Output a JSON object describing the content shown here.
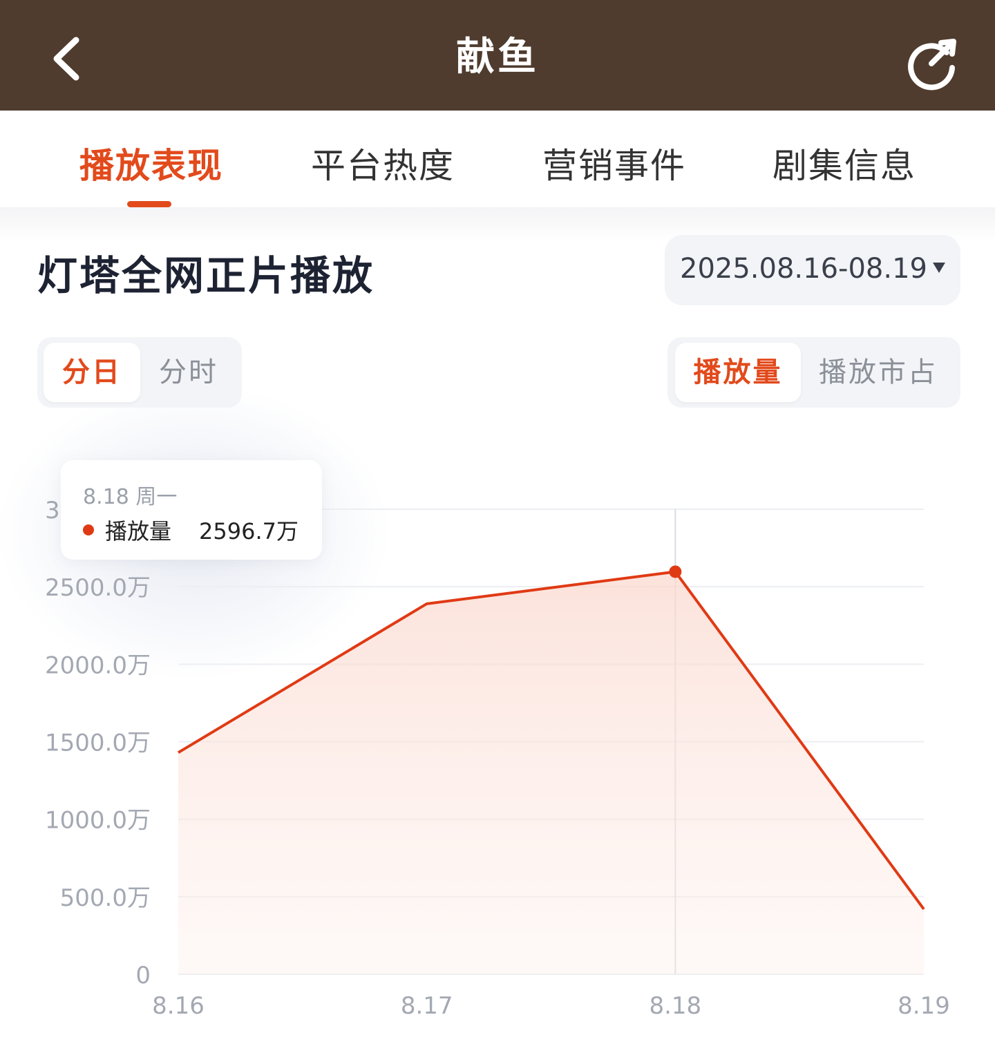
{
  "header": {
    "title": "献鱼",
    "back_icon": "chevron-left-icon",
    "refresh_icon": "refresh-icon",
    "background_color": "#4f3c2e"
  },
  "tabs": [
    {
      "label": "播放表现",
      "active": true
    },
    {
      "label": "平台热度",
      "active": false
    },
    {
      "label": "营销事件",
      "active": false
    },
    {
      "label": "剧集信息",
      "active": false
    }
  ],
  "section": {
    "title": "灯塔全网正片播放",
    "date_range": "2025.08.16-08.19"
  },
  "granularity": [
    {
      "label": "分日",
      "active": true
    },
    {
      "label": "分时",
      "active": false
    }
  ],
  "metric": [
    {
      "label": "播放量",
      "active": true
    },
    {
      "label": "播放市占",
      "active": false
    }
  ],
  "accent_color": "#e24a1c",
  "tooltip": {
    "date": "8.18  周一",
    "series": "播放量",
    "value": "2596.7万"
  },
  "chart_data": {
    "type": "area",
    "categories": [
      "8.16",
      "8.17",
      "8.18",
      "8.19"
    ],
    "series": [
      {
        "name": "播放量",
        "values": [
          1430,
          2390,
          2596.7,
          420
        ],
        "color": "#e03a14"
      }
    ],
    "y_unit": "万",
    "y_ticks": [
      "0",
      "500.0万",
      "1000.0万",
      "1500.0万",
      "2000.0万",
      "2500.0万",
      "3000.0万"
    ],
    "y_tick_values": [
      0,
      500,
      1000,
      1500,
      2000,
      2500,
      3000
    ],
    "ylim": [
      0,
      3000
    ],
    "grid": true,
    "highlight_category": "8.18"
  }
}
